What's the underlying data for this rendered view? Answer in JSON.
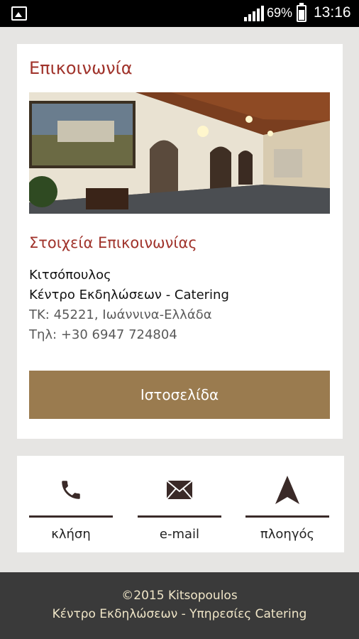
{
  "status_bar": {
    "battery_percent": "69%",
    "time": "13:16",
    "icons": [
      "image-notification-icon",
      "signal-icon",
      "battery-icon"
    ]
  },
  "card": {
    "title": "Επικοινωνία",
    "section_title": "Στοιχεία Επικοινωνίας",
    "contact": {
      "name": "Κιτσόπουλος",
      "business": "Κέντρο Εκδηλώσεων - Catering",
      "address": "ΤΚ: 45221, Ιωάννινα-Ελλάδα",
      "phone": "Τηλ: +30 6947 724804"
    },
    "website_button": "Ιστοσελίδα"
  },
  "actions": [
    {
      "label": "κλήση",
      "icon": "phone-icon"
    },
    {
      "label": "e-mail",
      "icon": "envelope-icon"
    },
    {
      "label": "πλοηγός",
      "icon": "navigation-arrow-icon"
    }
  ],
  "footer": {
    "line1": "©2015 Kitsopoulos",
    "line2": "Κέντρο Εκδηλώσεων - Υπηρεσίες Catering"
  },
  "colors": {
    "accent_red": "#a0332b",
    "button_gold": "#9a7b4f",
    "footer_bg": "#3a3a3a",
    "footer_text": "#f0e6c8"
  }
}
